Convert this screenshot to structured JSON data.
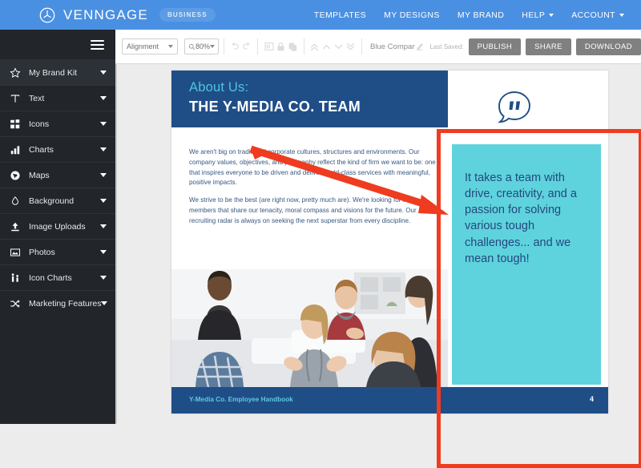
{
  "app": {
    "brand_name": "VENNGAGE",
    "plan_badge": "BUSINESS",
    "logo_icon": "venngage-circle-logo",
    "nav": [
      {
        "label": "TEMPLATES",
        "has_caret": false
      },
      {
        "label": "MY DESIGNS",
        "has_caret": false
      },
      {
        "label": "MY BRAND",
        "has_caret": false
      },
      {
        "label": "HELP",
        "has_caret": true
      },
      {
        "label": "ACCOUNT",
        "has_caret": true
      }
    ]
  },
  "sidebar": {
    "menu_icon": "hamburger-icon",
    "items": [
      {
        "label": "My Brand Kit",
        "icon": "star-icon",
        "active": true
      },
      {
        "label": "Text",
        "icon": "text-t-icon",
        "active": false
      },
      {
        "label": "Icons",
        "icon": "icons-grid-icon",
        "active": false
      },
      {
        "label": "Charts",
        "icon": "bar-chart-icon",
        "active": false
      },
      {
        "label": "Maps",
        "icon": "globe-icon",
        "active": false
      },
      {
        "label": "Background",
        "icon": "droplet-icon",
        "active": false
      },
      {
        "label": "Image Uploads",
        "icon": "upload-arrow-icon",
        "active": false
      },
      {
        "label": "Photos",
        "icon": "photo-frame-icon",
        "active": false
      },
      {
        "label": "Icon Charts",
        "icon": "pictogram-icon",
        "active": false
      },
      {
        "label": "Marketing Features",
        "icon": "shuffle-arrows-icon",
        "active": false
      }
    ]
  },
  "toolbar": {
    "alignment_label": "Alignment",
    "zoom_value": "80%",
    "zoom_icon": "magnifier-icon",
    "icons": [
      "undo-icon",
      "redo-icon",
      "frame-icon",
      "lock-icon",
      "duplicate-icon",
      "bring-to-front-icon",
      "bring-forward-icon",
      "send-backward-icon",
      "send-to-back-icon"
    ],
    "document_name": "Blue Company E...",
    "edit_name_icon": "pencil-edit-icon",
    "last_saved_label": "Last Saved:",
    "publish_label": "PUBLISH",
    "share_label": "SHARE",
    "download_label": "DOWNLOAD"
  },
  "canvas": {
    "header": {
      "subtitle": "About Us:",
      "title": "THE Y-MEDIA CO. TEAM"
    },
    "paragraphs": [
      "We aren't big on traditional corporate cultures, structures and environments. Our company values, objectives, and philosophy reflect the kind of firm we want to be: one that inspires everyone to be driven and deliver world-class services with meaningful, positive impacts.",
      "We strive to be the best (are right now, pretty much are). We're looking for team members that share our tenacity, moral compass and visions for the future. Our recruiting radar is always on seeking the next superstar from every discipline."
    ],
    "quote_icon": "speech-bubble-quote-icon",
    "quote_text": "It takes a team with drive, creativity, and a passion for solving various tough challenges... and we mean tough!",
    "photo_alt": "team-meeting-photo",
    "footer_text": "Y-Media Co. Employee Handbook",
    "page_number": "4"
  },
  "annotations": {
    "selection_box": "red-selection-rectangle",
    "arrow": "red-pointer-arrow"
  },
  "colors": {
    "brand_blue": "#4a90e2",
    "sidebar_dark": "#22262b",
    "deck_navy": "#1f4e87",
    "accent_cyan": "#5ed3dd",
    "annotation_red": "#ef3b1f"
  }
}
